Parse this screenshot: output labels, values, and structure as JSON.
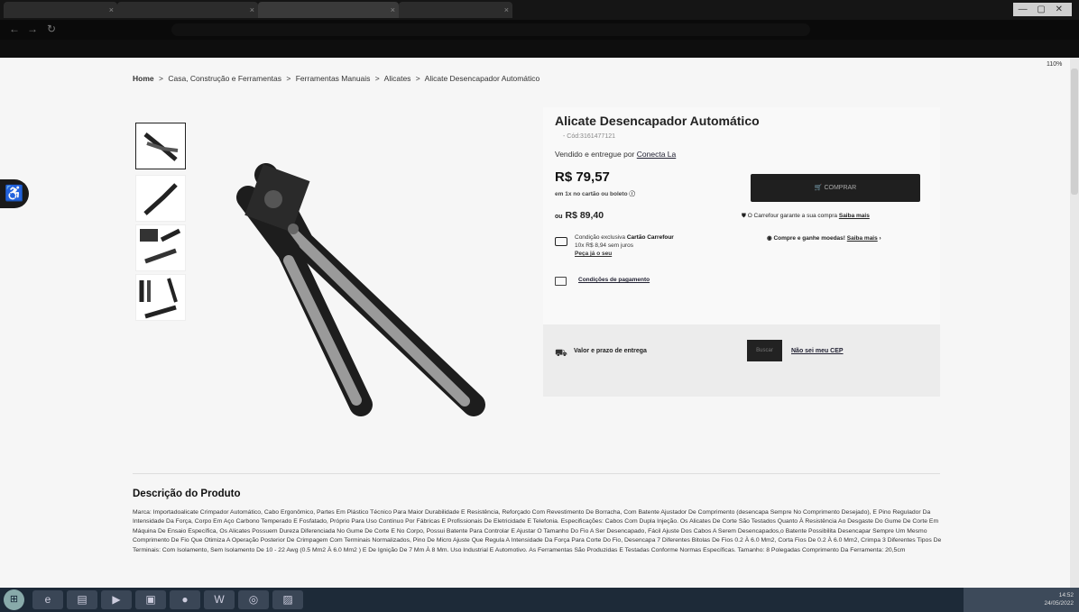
{
  "breadcrumb": {
    "home": "Home",
    "sep": ">",
    "c1": "Casa, Construção e Ferramentas",
    "c2": "Ferramentas Manuais",
    "c3": "Alicates",
    "current": "Alicate Desencapador Automático"
  },
  "product": {
    "title": "Alicate Desencapador Automático",
    "code": "- Cód:3161477121",
    "sold_by_prefix": "Vendido e entregue por",
    "seller": "Conecta La",
    "price": "R$ 79,57",
    "installment": "em 1x no cartão ou boleto ⓘ",
    "alt_price_prefix": "ou",
    "alt_price": "R$ 89,40",
    "card_condition_prefix": "Condição exclusiva",
    "card_condition_brand": "Cartão Carrefour",
    "card_installments": "10x R$ 8,94 sem juros",
    "card_link": "Peça já o seu",
    "payment_conditions": "Condições de pagamento"
  },
  "buy": {
    "button": "COMPRAR",
    "guarantee": "O Carrefour garante a sua compra",
    "guarantee_link": "Saiba mais",
    "coins": "Compre e ganhe moedas!",
    "coins_link": "Saiba mais",
    "coins_arrow": "›"
  },
  "delivery": {
    "label": "Valor e prazo de entrega",
    "button": "Buscar",
    "no_cep": "Não sei meu CEP"
  },
  "description": {
    "title": "Descrição do Produto",
    "text": "Marca: Importadoalicate Crimpador Automático, Cabo Ergonômico, Partes Em Plástico Técnico Para Maior Durabilidade E Resistência, Reforçado Com Revestimento De Borracha, Com Batente Ajustador De Comprimento (desencapa Sempre No Comprimento Desejado), E Pino Regulador Da Intensidade Da Força, Corpo Em Aço Carbono Temperado E Fosfatado, Próprio Para Uso Contínuo Por Fábricas E Profissionais De Eletricidade E Telefonia. Especificações: Cabos Com Dupla Injeção. Os Alicates De Corte São Testados Quanto À Resistência Ao Desgaste Do Gume De Corte Em Máquina De Ensaio Específica, Os Alicates Possuem Dureza Diferenciada No Gume De Corte E No Corpo, Possui Batente Para Controlar E Ajustar O Tamanho Do Fio A Ser Desencapado, Fácil Ajuste Dos Cabos A Serem Desencapados,o Batente Possibilita Desencapar Sempre Um Mesmo Comprimento De Fio Que Otimiza A Operação Posterior De Crimpagem Com Terminais Normalizados, Pino De Micro Ajuste Que Regula A Intensidade Da Força Para Corte Do Fio, Desencapa 7 Diferentes Bitolas De Fios 0.2 À 6.0 Mm2, Corta Fios De 0.2 À 6.0 Mm2, Crimpa 3 Diferentes Tipos De Terminais: Com Isolamento, Sem Isolamento De 10 - 22 Awg (0.5 Mm2 À 6.0 Mm2 ) E De Ignição De 7 Mm À 8 Mm. Uso Industrial E Automotivo. As Ferramentas São Produzidas E Testadas Conforme Normas Específicas. Tamanho: 8 Polegadas Comprimento Da Ferramenta: 20,5cm"
  },
  "page": {
    "zoom": "110%",
    "a11y_icon": "accessibility-icon"
  },
  "browser": {
    "tab_close": "×",
    "window_controls": "— ▢ ✕"
  },
  "taskbar": {
    "time": "14:52",
    "date": "24/05/2022"
  },
  "colors": {
    "buy_button": "#1f1f1f",
    "page_bg": "#f6f6f6",
    "text": "#222222"
  }
}
